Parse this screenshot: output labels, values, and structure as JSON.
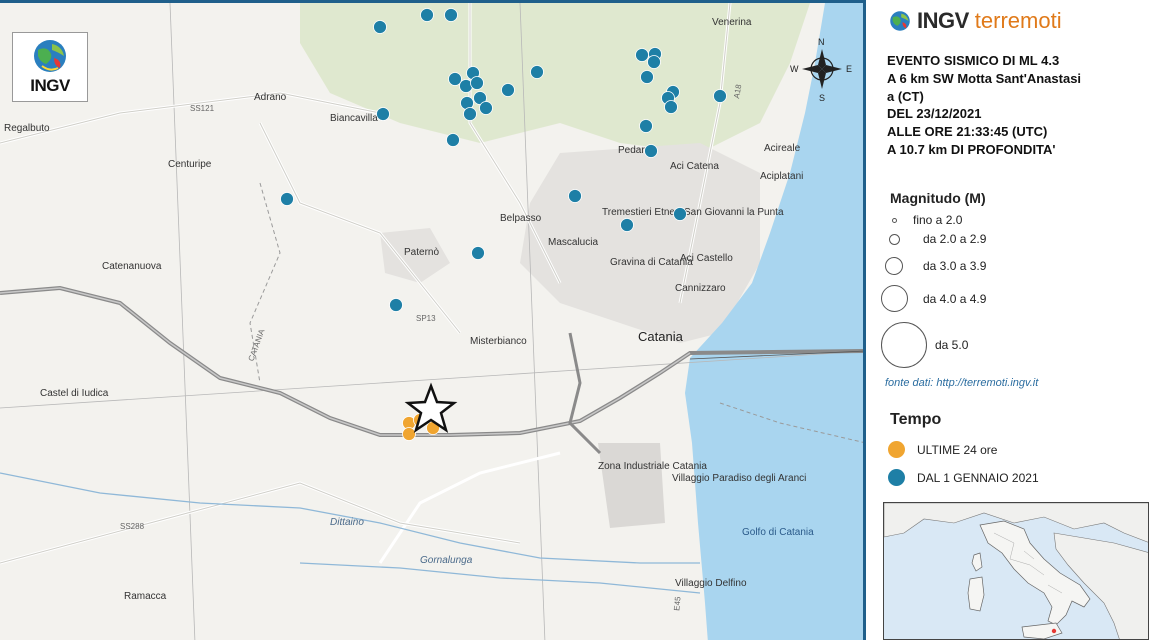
{
  "brand": {
    "ingv": "INGV",
    "terremoti": "terremoti"
  },
  "map_logo": {
    "text": "INGV"
  },
  "event": {
    "line1": "EVENTO SISMICO DI ML 4.3",
    "line2": "A 6 km SW Motta Sant'Anastasi",
    "line3": "a (CT)",
    "line4": "DEL 23/12/2021",
    "line5": "ALLE ORE 21:33:45 (UTC)",
    "line6": "A 10.7 km DI PROFONDITA'"
  },
  "magnitude_legend": {
    "title": "Magnitudo (M)",
    "items": [
      {
        "label": "fino a 2.0"
      },
      {
        "label": "da 2.0 a 2.9"
      },
      {
        "label": "da 3.0 a 3.9"
      },
      {
        "label": "da 4.0 a 4.9"
      },
      {
        "label": "da 5.0"
      }
    ]
  },
  "source": "fonte dati: http://terremoti.ingv.it",
  "tempo_legend": {
    "title": "Tempo",
    "items": [
      {
        "label": "ULTIME 24 ore",
        "color": "#f0a530"
      },
      {
        "label": "DAL 1 GENNAIO 2021",
        "color": "#1e7fa6"
      }
    ]
  },
  "colors": {
    "recent": "#f0a530",
    "year": "#1e7fa6",
    "sea": "#a9d5ef",
    "frame": "#1f5f8b"
  },
  "places": [
    {
      "name": "Adrano"
    },
    {
      "name": "Biancavilla"
    },
    {
      "name": "Regalbuto"
    },
    {
      "name": "Centuripe"
    },
    {
      "name": "Catenanuova"
    },
    {
      "name": "Paternò"
    },
    {
      "name": "Belpasso"
    },
    {
      "name": "Mascalucia"
    },
    {
      "name": "Tremestieri Etneo"
    },
    {
      "name": "San Giovanni la Punta"
    },
    {
      "name": "Gravina di Catania"
    },
    {
      "name": "Aci Castello"
    },
    {
      "name": "Cannizzaro"
    },
    {
      "name": "Catania"
    },
    {
      "name": "Misterbianco"
    },
    {
      "name": "Pedara"
    },
    {
      "name": "Aci Catena"
    },
    {
      "name": "Acireale"
    },
    {
      "name": "Aciplatani"
    },
    {
      "name": "Castel di Iudica"
    },
    {
      "name": "Ramacca"
    },
    {
      "name": "Villaggio Paradiso degli Aranci"
    },
    {
      "name": "Zona Industriale Catania"
    },
    {
      "name": "Villaggio Delfino"
    },
    {
      "name": "Golfo di Catania"
    },
    {
      "name": "Dittaino"
    },
    {
      "name": "Gornalunga"
    },
    {
      "name": "Venerina"
    }
  ],
  "compass": {
    "n": "N",
    "s": "S",
    "e": "E",
    "w": "W"
  }
}
